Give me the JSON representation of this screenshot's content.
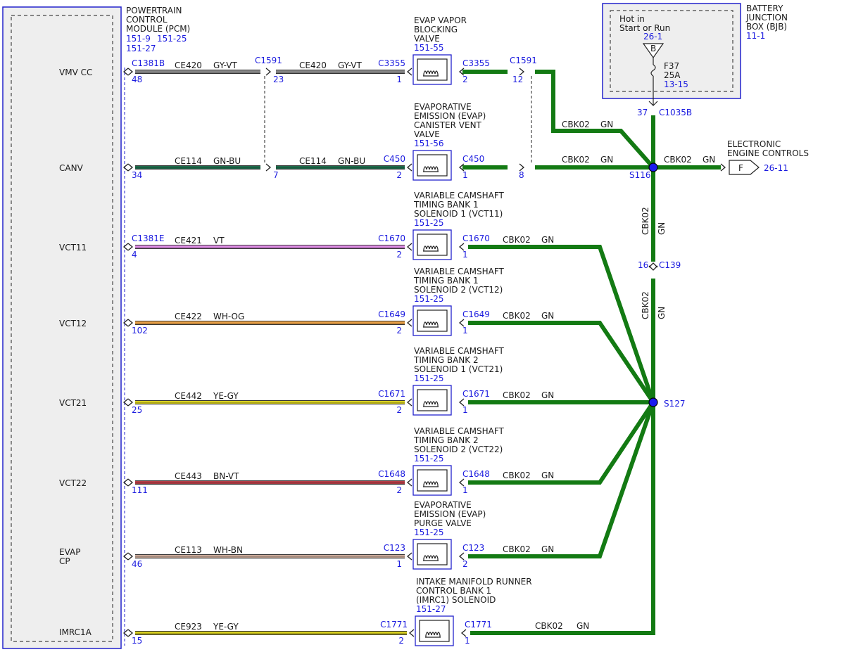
{
  "pcm": {
    "title": [
      "POWERTRAIN",
      "CONTROL",
      "MODULE (PCM)"
    ],
    "refs": [
      "151-9",
      "151-25",
      "151-27"
    ],
    "pins": [
      "VMV CC",
      "CANV",
      "VCT11",
      "VCT12",
      "VCT21",
      "VCT22",
      "EVAP",
      "CP",
      "IMRC1A"
    ]
  },
  "bjb": {
    "title": [
      "BATTERY",
      "JUNCTION",
      "BOX (BJB)"
    ],
    "ref": "11-1",
    "hot_text": [
      "Hot in",
      "Start or Run"
    ],
    "bus_ref": "26-1",
    "bus_letter": "B",
    "fuse": "F37",
    "fuse_rating": "25A",
    "fuse_ref": "13-15",
    "conn_pin": "37",
    "conn": "C1035B"
  },
  "eec": {
    "title": [
      "ELECTRONIC",
      "ENGINE CONTROLS"
    ],
    "letter": "F",
    "ref": "26-11"
  },
  "wire_colors": {
    "GY-VT": "#8a8a8a",
    "GN-BU": "#1d6a4a",
    "VT": "#e08ee6",
    "WH-OG": "#e8a048",
    "YE-GY": "#d8d020",
    "BN-VT": "#b43c44",
    "WH-BN": "#c8a898",
    "GN": "#137a13"
  },
  "rows": [
    {
      "pcm_conn": "C1381B",
      "pcm_pin": "48",
      "circuit": "CE420",
      "color": "GY-VT",
      "inline_conn": "C1591",
      "inline_pin_l": "23",
      "comp_conn": "C3355",
      "comp_pin_in": "1",
      "comp_conn_out": "C3355",
      "comp_pin_out": "2",
      "comp_name": [
        "EVAP VAPOR",
        "BLOCKING",
        "VALVE"
      ],
      "comp_ref": "151-55",
      "gnd_circuit": "CBK02",
      "gnd_color": "GN",
      "gnd_inline_conn": "C1591",
      "gnd_inline_pin": "12"
    },
    {
      "pcm_conn": "",
      "pcm_pin": "34",
      "circuit": "CE114",
      "color": "GN-BU",
      "inline_pin_l": "7",
      "comp_conn": "C450",
      "comp_pin_in": "2",
      "comp_conn_out": "C450",
      "comp_pin_out": "1",
      "comp_name": [
        "EVAPORATIVE",
        "EMISSION (EVAP)",
        "CANISTER VENT",
        "VALVE"
      ],
      "comp_ref": "151-56",
      "gnd_circuit": "CBK02",
      "gnd_color": "GN",
      "gnd_inline_pin": "8"
    },
    {
      "pcm_conn": "C1381E",
      "pcm_pin": "4",
      "circuit": "CE421",
      "color": "VT",
      "comp_conn": "C1670",
      "comp_pin_in": "2",
      "comp_conn_out": "C1670",
      "comp_pin_out": "1",
      "comp_name": [
        "VARIABLE CAMSHAFT",
        "TIMING BANK 1",
        "SOLENOID 1 (VCT11)"
      ],
      "comp_ref": "151-25",
      "gnd_circuit": "CBK02",
      "gnd_color": "GN"
    },
    {
      "pcm_conn": "",
      "pcm_pin": "102",
      "circuit": "CE422",
      "color": "WH-OG",
      "comp_conn": "C1649",
      "comp_pin_in": "2",
      "comp_conn_out": "C1649",
      "comp_pin_out": "1",
      "comp_name": [
        "VARIABLE CAMSHAFT",
        "TIMING BANK 1",
        "SOLENOID 2 (VCT12)"
      ],
      "comp_ref": "151-25",
      "gnd_circuit": "CBK02",
      "gnd_color": "GN"
    },
    {
      "pcm_conn": "",
      "pcm_pin": "25",
      "circuit": "CE442",
      "color": "YE-GY",
      "comp_conn": "C1671",
      "comp_pin_in": "2",
      "comp_conn_out": "C1671",
      "comp_pin_out": "1",
      "comp_name": [
        "VARIABLE CAMSHAFT",
        "TIMING BANK 2",
        "SOLENOID 1 (VCT21)"
      ],
      "comp_ref": "151-25",
      "gnd_circuit": "CBK02",
      "gnd_color": "GN"
    },
    {
      "pcm_conn": "",
      "pcm_pin": "111",
      "circuit": "CE443",
      "color": "BN-VT",
      "comp_conn": "C1648",
      "comp_pin_in": "2",
      "comp_conn_out": "C1648",
      "comp_pin_out": "1",
      "comp_name": [
        "VARIABLE CAMSHAFT",
        "TIMING BANK 2",
        "SOLENOID 2 (VCT22)"
      ],
      "comp_ref": "151-25",
      "gnd_circuit": "CBK02",
      "gnd_color": "GN"
    },
    {
      "pcm_conn": "",
      "pcm_pin": "46",
      "circuit": "CE113",
      "color": "WH-BN",
      "comp_conn": "C123",
      "comp_pin_in": "1",
      "comp_conn_out": "C123",
      "comp_pin_out": "2",
      "comp_name": [
        "EVAPORATIVE",
        "EMISSION (EVAP)",
        "PURGE VALVE"
      ],
      "comp_ref": "151-25",
      "gnd_circuit": "CBK02",
      "gnd_color": "GN"
    },
    {
      "pcm_conn": "",
      "pcm_pin": "15",
      "circuit": "CE923",
      "color": "YE-GY",
      "comp_conn": "C1771",
      "comp_pin_in": "2",
      "comp_conn_out": "C1771",
      "comp_pin_out": "1",
      "comp_name": [
        "INTAKE MANIFOLD RUNNER",
        "CONTROL BANK 1",
        "(IMRC1) SOLENOID"
      ],
      "comp_ref": "151-27",
      "gnd_circuit": "CBK02",
      "gnd_color": "GN"
    }
  ],
  "splices": {
    "upper": "S116",
    "lower": "S127"
  },
  "feed": {
    "circuit": "CBK02",
    "color": "GN",
    "conn": "C139",
    "pin": "16"
  },
  "eec_wire": {
    "circuit": "CBK02",
    "color": "GN"
  }
}
